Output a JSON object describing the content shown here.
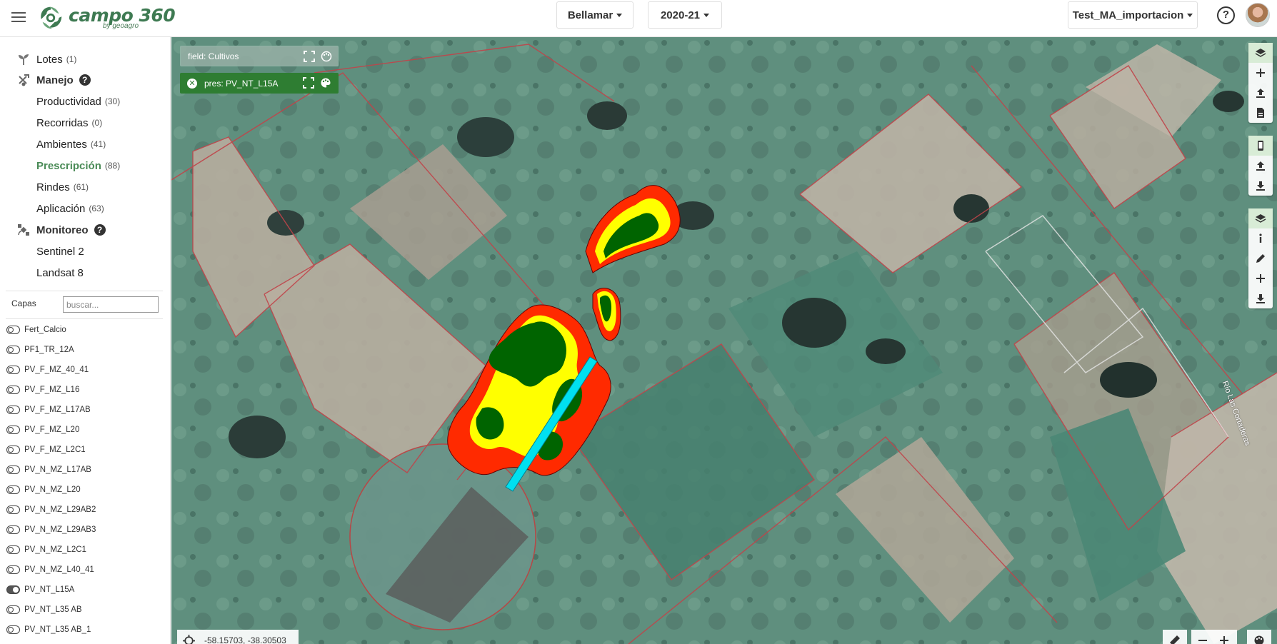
{
  "header": {
    "brand": "campo 360",
    "tagline": "by geoagro",
    "org_select": "Bellamar",
    "season_select": "2020-21",
    "account_select": "Test_MA_importacion"
  },
  "sidebar": {
    "lotes": {
      "label": "Lotes",
      "count": "(1)"
    },
    "manejo": {
      "label": "Manejo"
    },
    "manejo_items": [
      {
        "label": "Productividad",
        "count": "(30)"
      },
      {
        "label": "Recorridas",
        "count": "(0)"
      },
      {
        "label": "Ambientes",
        "count": "(41)"
      },
      {
        "label": "Prescripción",
        "count": "(88)"
      },
      {
        "label": "Rindes",
        "count": "(61)"
      },
      {
        "label": "Aplicación",
        "count": "(63)"
      }
    ],
    "monitoreo": {
      "label": "Monitoreo"
    },
    "monitoreo_items": [
      {
        "label": "Sentinel 2"
      },
      {
        "label": "Landsat 8"
      }
    ],
    "capas_label": "Capas",
    "search_placeholder": "buscar...",
    "layers": [
      {
        "name": "Fert_Calcio",
        "on": false
      },
      {
        "name": "PF1_TR_12A",
        "on": false
      },
      {
        "name": "PV_F_MZ_40_41",
        "on": false
      },
      {
        "name": "PV_F_MZ_L16",
        "on": false
      },
      {
        "name": "PV_F_MZ_L17AB",
        "on": false
      },
      {
        "name": "PV_F_MZ_L20",
        "on": false
      },
      {
        "name": "PV_F_MZ_L2C1",
        "on": false
      },
      {
        "name": "PV_N_MZ_L17AB",
        "on": false
      },
      {
        "name": "PV_N_MZ_L20",
        "on": false
      },
      {
        "name": "PV_N_MZ_L29AB2",
        "on": false
      },
      {
        "name": "PV_N_MZ_L29AB3",
        "on": false
      },
      {
        "name": "PV_N_MZ_L2C1",
        "on": false
      },
      {
        "name": "PV_N_MZ_L40_41",
        "on": false
      },
      {
        "name": "PV_NT_L15A",
        "on": true
      },
      {
        "name": "PV_NT_L35 AB",
        "on": false
      },
      {
        "name": "PV_NT_L35 AB_1",
        "on": false
      }
    ]
  },
  "map": {
    "field_chip": "field: Cultivos",
    "pres_chip": "pres: PV_NT_L15A",
    "coordinates": "-58.15703, -38.30503",
    "river_label": "Río Las Cortaderas",
    "colors": {
      "prescription_high": "#006400",
      "prescription_mid": "#ffff00",
      "prescription_low": "#ff2a00",
      "strip": "#00e0f0",
      "brand": "#4a8b57"
    }
  },
  "icons": {
    "menu": "hamburger-icon",
    "help": "question-circle-icon",
    "layers": "layers-icon",
    "add": "plus-icon",
    "upload": "upload-icon",
    "pdf": "document-icon",
    "mobile": "mobile-icon",
    "download": "download-icon",
    "info": "info-icon",
    "edit": "pencil-icon",
    "palette": "palette-icon",
    "fullscreen": "expand-icon",
    "crosshair": "crosshair-icon",
    "ruler": "ruler-icon"
  }
}
